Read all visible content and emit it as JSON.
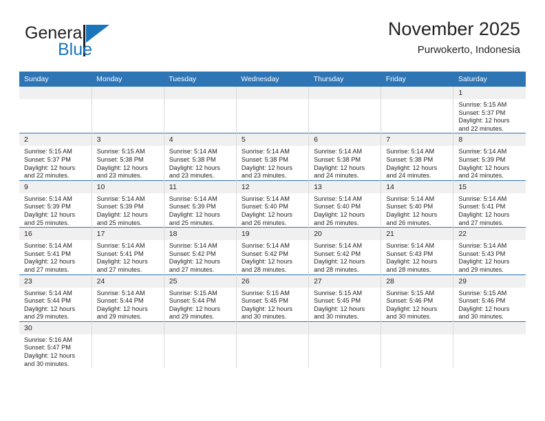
{
  "brand": {
    "name_top": "General",
    "name_bottom": "Blue",
    "accent_color": "#1b75bb"
  },
  "header": {
    "title": "November 2025",
    "subtitle": "Purwokerto, Indonesia"
  },
  "theme": {
    "header_row_color": "#2e75b6",
    "daynum_band_color": "#f0f0f0",
    "grid_line_color": "#d9d9d9"
  },
  "weekdays": [
    "Sunday",
    "Monday",
    "Tuesday",
    "Wednesday",
    "Thursday",
    "Friday",
    "Saturday"
  ],
  "weeks": [
    [
      {
        "day": "",
        "empty": true
      },
      {
        "day": "",
        "empty": true
      },
      {
        "day": "",
        "empty": true
      },
      {
        "day": "",
        "empty": true
      },
      {
        "day": "",
        "empty": true
      },
      {
        "day": "",
        "empty": true
      },
      {
        "day": "1",
        "sunrise": "Sunrise: 5:15 AM",
        "sunset": "Sunset: 5:37 PM",
        "daylight_1": "Daylight: 12 hours",
        "daylight_2": "and 22 minutes."
      }
    ],
    [
      {
        "day": "2",
        "sunrise": "Sunrise: 5:15 AM",
        "sunset": "Sunset: 5:37 PM",
        "daylight_1": "Daylight: 12 hours",
        "daylight_2": "and 22 minutes."
      },
      {
        "day": "3",
        "sunrise": "Sunrise: 5:15 AM",
        "sunset": "Sunset: 5:38 PM",
        "daylight_1": "Daylight: 12 hours",
        "daylight_2": "and 23 minutes."
      },
      {
        "day": "4",
        "sunrise": "Sunrise: 5:14 AM",
        "sunset": "Sunset: 5:38 PM",
        "daylight_1": "Daylight: 12 hours",
        "daylight_2": "and 23 minutes."
      },
      {
        "day": "5",
        "sunrise": "Sunrise: 5:14 AM",
        "sunset": "Sunset: 5:38 PM",
        "daylight_1": "Daylight: 12 hours",
        "daylight_2": "and 23 minutes."
      },
      {
        "day": "6",
        "sunrise": "Sunrise: 5:14 AM",
        "sunset": "Sunset: 5:38 PM",
        "daylight_1": "Daylight: 12 hours",
        "daylight_2": "and 24 minutes."
      },
      {
        "day": "7",
        "sunrise": "Sunrise: 5:14 AM",
        "sunset": "Sunset: 5:38 PM",
        "daylight_1": "Daylight: 12 hours",
        "daylight_2": "and 24 minutes."
      },
      {
        "day": "8",
        "sunrise": "Sunrise: 5:14 AM",
        "sunset": "Sunset: 5:39 PM",
        "daylight_1": "Daylight: 12 hours",
        "daylight_2": "and 24 minutes."
      }
    ],
    [
      {
        "day": "9",
        "sunrise": "Sunrise: 5:14 AM",
        "sunset": "Sunset: 5:39 PM",
        "daylight_1": "Daylight: 12 hours",
        "daylight_2": "and 25 minutes."
      },
      {
        "day": "10",
        "sunrise": "Sunrise: 5:14 AM",
        "sunset": "Sunset: 5:39 PM",
        "daylight_1": "Daylight: 12 hours",
        "daylight_2": "and 25 minutes."
      },
      {
        "day": "11",
        "sunrise": "Sunrise: 5:14 AM",
        "sunset": "Sunset: 5:39 PM",
        "daylight_1": "Daylight: 12 hours",
        "daylight_2": "and 25 minutes."
      },
      {
        "day": "12",
        "sunrise": "Sunrise: 5:14 AM",
        "sunset": "Sunset: 5:40 PM",
        "daylight_1": "Daylight: 12 hours",
        "daylight_2": "and 26 minutes."
      },
      {
        "day": "13",
        "sunrise": "Sunrise: 5:14 AM",
        "sunset": "Sunset: 5:40 PM",
        "daylight_1": "Daylight: 12 hours",
        "daylight_2": "and 26 minutes."
      },
      {
        "day": "14",
        "sunrise": "Sunrise: 5:14 AM",
        "sunset": "Sunset: 5:40 PM",
        "daylight_1": "Daylight: 12 hours",
        "daylight_2": "and 26 minutes."
      },
      {
        "day": "15",
        "sunrise": "Sunrise: 5:14 AM",
        "sunset": "Sunset: 5:41 PM",
        "daylight_1": "Daylight: 12 hours",
        "daylight_2": "and 27 minutes."
      }
    ],
    [
      {
        "day": "16",
        "sunrise": "Sunrise: 5:14 AM",
        "sunset": "Sunset: 5:41 PM",
        "daylight_1": "Daylight: 12 hours",
        "daylight_2": "and 27 minutes."
      },
      {
        "day": "17",
        "sunrise": "Sunrise: 5:14 AM",
        "sunset": "Sunset: 5:41 PM",
        "daylight_1": "Daylight: 12 hours",
        "daylight_2": "and 27 minutes."
      },
      {
        "day": "18",
        "sunrise": "Sunrise: 5:14 AM",
        "sunset": "Sunset: 5:42 PM",
        "daylight_1": "Daylight: 12 hours",
        "daylight_2": "and 27 minutes."
      },
      {
        "day": "19",
        "sunrise": "Sunrise: 5:14 AM",
        "sunset": "Sunset: 5:42 PM",
        "daylight_1": "Daylight: 12 hours",
        "daylight_2": "and 28 minutes."
      },
      {
        "day": "20",
        "sunrise": "Sunrise: 5:14 AM",
        "sunset": "Sunset: 5:42 PM",
        "daylight_1": "Daylight: 12 hours",
        "daylight_2": "and 28 minutes."
      },
      {
        "day": "21",
        "sunrise": "Sunrise: 5:14 AM",
        "sunset": "Sunset: 5:43 PM",
        "daylight_1": "Daylight: 12 hours",
        "daylight_2": "and 28 minutes."
      },
      {
        "day": "22",
        "sunrise": "Sunrise: 5:14 AM",
        "sunset": "Sunset: 5:43 PM",
        "daylight_1": "Daylight: 12 hours",
        "daylight_2": "and 29 minutes."
      }
    ],
    [
      {
        "day": "23",
        "sunrise": "Sunrise: 5:14 AM",
        "sunset": "Sunset: 5:44 PM",
        "daylight_1": "Daylight: 12 hours",
        "daylight_2": "and 29 minutes."
      },
      {
        "day": "24",
        "sunrise": "Sunrise: 5:14 AM",
        "sunset": "Sunset: 5:44 PM",
        "daylight_1": "Daylight: 12 hours",
        "daylight_2": "and 29 minutes."
      },
      {
        "day": "25",
        "sunrise": "Sunrise: 5:15 AM",
        "sunset": "Sunset: 5:44 PM",
        "daylight_1": "Daylight: 12 hours",
        "daylight_2": "and 29 minutes."
      },
      {
        "day": "26",
        "sunrise": "Sunrise: 5:15 AM",
        "sunset": "Sunset: 5:45 PM",
        "daylight_1": "Daylight: 12 hours",
        "daylight_2": "and 30 minutes."
      },
      {
        "day": "27",
        "sunrise": "Sunrise: 5:15 AM",
        "sunset": "Sunset: 5:45 PM",
        "daylight_1": "Daylight: 12 hours",
        "daylight_2": "and 30 minutes."
      },
      {
        "day": "28",
        "sunrise": "Sunrise: 5:15 AM",
        "sunset": "Sunset: 5:46 PM",
        "daylight_1": "Daylight: 12 hours",
        "daylight_2": "and 30 minutes."
      },
      {
        "day": "29",
        "sunrise": "Sunrise: 5:15 AM",
        "sunset": "Sunset: 5:46 PM",
        "daylight_1": "Daylight: 12 hours",
        "daylight_2": "and 30 minutes."
      }
    ],
    [
      {
        "day": "30",
        "sunrise": "Sunrise: 5:16 AM",
        "sunset": "Sunset: 5:47 PM",
        "daylight_1": "Daylight: 12 hours",
        "daylight_2": "and 30 minutes."
      },
      {
        "day": "",
        "empty": true
      },
      {
        "day": "",
        "empty": true
      },
      {
        "day": "",
        "empty": true
      },
      {
        "day": "",
        "empty": true
      },
      {
        "day": "",
        "empty": true
      },
      {
        "day": "",
        "empty": true
      }
    ]
  ]
}
